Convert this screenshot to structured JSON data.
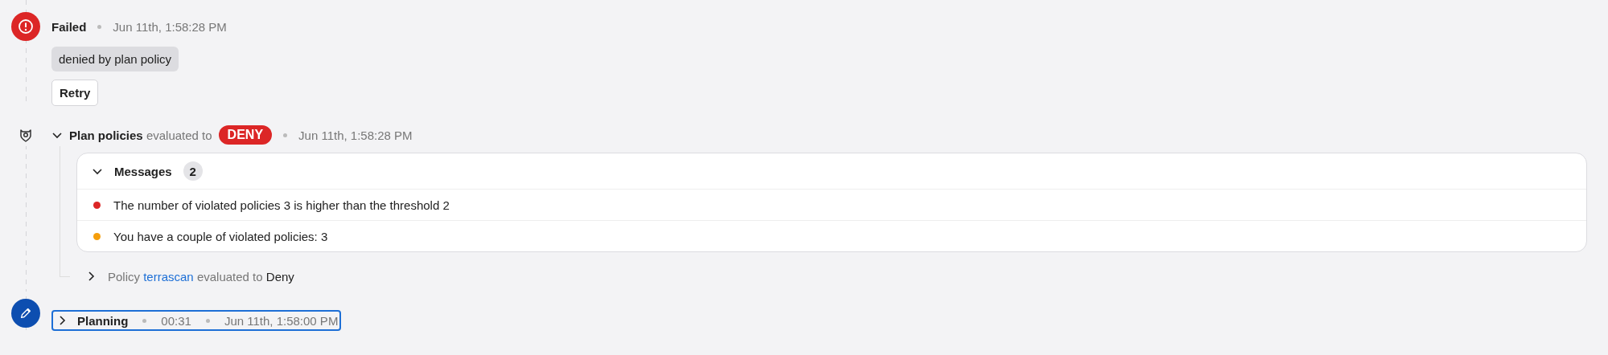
{
  "events": [
    {
      "kind": "failed",
      "status": "Failed",
      "time": "Jun 11th, 1:58:28 PM",
      "reason": "denied by plan policy",
      "action": "Retry"
    },
    {
      "kind": "policy",
      "expanded": true,
      "title": "Plan policies",
      "verb": "evaluated to",
      "badge": "DENY",
      "time": "Jun 11th, 1:58:28 PM",
      "messages": {
        "title": "Messages",
        "count": "2",
        "expanded": true,
        "items": [
          {
            "text": "The number of violated policies 3 is higher than the threshold 2",
            "color": "#dc2626"
          },
          {
            "text": "You have a couple of violated policies: 3",
            "color": "#f59e0b"
          }
        ]
      },
      "policies": [
        {
          "expanded": false,
          "prefix": "Policy",
          "name": "terrascan",
          "verb": "evaluated to",
          "result": "Deny"
        }
      ]
    },
    {
      "kind": "planning",
      "expanded": false,
      "focused": true,
      "title": "Planning",
      "duration": "00:31",
      "time": "Jun 11th, 1:58:00 PM"
    }
  ]
}
